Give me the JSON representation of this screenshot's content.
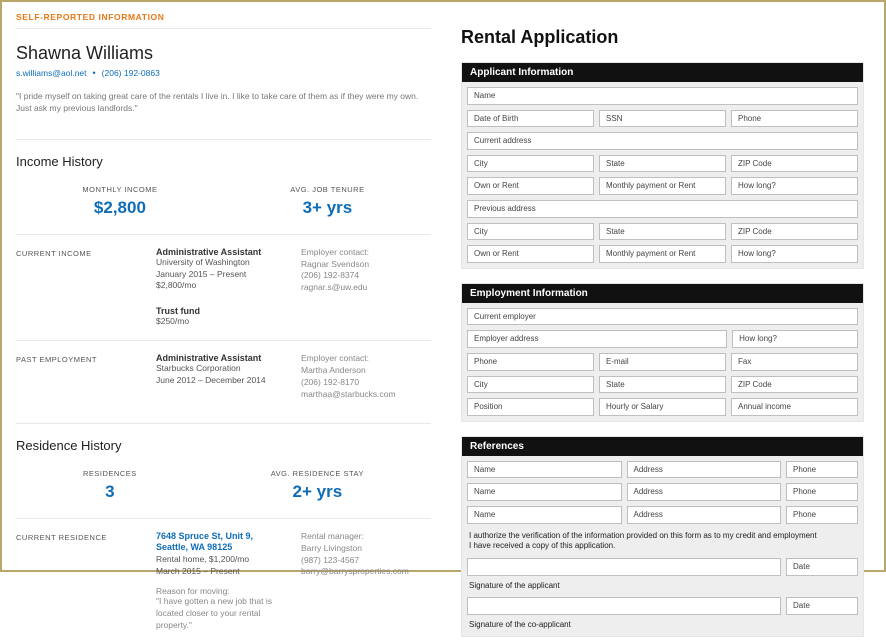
{
  "left": {
    "headerTag": "SELF-REPORTED INFORMATION",
    "name": "Shawna Williams",
    "email": "s.williams@aol.net",
    "phone": "(206) 192-0863",
    "quote": "\"I pride myself on taking great care of the rentals I live in. I like to take care of them as if they were my own. Just ask my previous landlords.\"",
    "income": {
      "heading": "Income History",
      "stats": {
        "monthlyLabel": "MONTHLY INCOME",
        "monthlyValue": "$2,800",
        "tenureLabel": "AVG. JOB TENURE",
        "tenureValue": "3+ yrs"
      },
      "current": {
        "label": "CURRENT INCOME",
        "job1": {
          "title": "Administrative Assistant",
          "org": "University of Washington",
          "dates": "January 2015 – Present",
          "amount": "$2,800/mo"
        },
        "job2": {
          "title": "Trust fund",
          "amount": "$250/mo"
        },
        "contactLabel": "Employer contact:",
        "contactName": "Ragnar Svendson",
        "contactPhone": "(206) 192-8374",
        "contactEmail": "ragnar.s@uw.edu"
      },
      "past": {
        "label": "PAST EMPLOYMENT",
        "title": "Administrative Assistant",
        "org": "Starbucks Corporation",
        "dates": "June 2012 – December 2014",
        "contactLabel": "Employer contact:",
        "contactName": "Martha Anderson",
        "contactPhone": "(206) 192-8170",
        "contactEmail": "marthaa@starbucks.com"
      }
    },
    "residence": {
      "heading": "Residence History",
      "stats": {
        "countLabel": "RESIDENCES",
        "countValue": "3",
        "stayLabel": "AVG. RESIDENCE STAY",
        "stayValue": "2+ yrs"
      },
      "current": {
        "label": "CURRENT RESIDENCE",
        "addr1": "7648 Spruce St, Unit 9,",
        "addr2": "Seattle, WA 98125",
        "sub": "Rental home, $1,200/mo",
        "dates": "March 2015 – Present",
        "reasonLabel": "Reason for moving:",
        "reasonText": "\"I have gotten a new job that is located closer to your rental property.\"",
        "contactLabel": "Rental manager:",
        "contactName": "Barry Livingston",
        "contactPhone": "(987) 123-4567",
        "contactEmail": "barry@barrysproperties.com"
      }
    }
  },
  "right": {
    "title": "Rental Application",
    "sections": {
      "applicant": {
        "heading": "Applicant Information",
        "f": {
          "name": "Name",
          "dob": "Date of Birth",
          "ssn": "SSN",
          "phone": "Phone",
          "currAddr": "Current address",
          "city": "City",
          "state": "State",
          "zip": "ZIP Code",
          "ownRent": "Own or Rent",
          "payment": "Monthly payment or Rent",
          "howLong": "How long?",
          "prevAddr": "Previous address"
        }
      },
      "employment": {
        "heading": "Employment Information",
        "f": {
          "emp": "Current employer",
          "empAddr": "Employer address",
          "howLong": "How long?",
          "phone": "Phone",
          "email": "E-mail",
          "fax": "Fax",
          "city": "City",
          "state": "State",
          "zip": "ZIP Code",
          "position": "Position",
          "hourly": "Hourly or Salary",
          "annual": "Annual income"
        }
      },
      "refs": {
        "heading": "References",
        "f": {
          "name": "Name",
          "address": "Address",
          "phone": "Phone"
        },
        "auth1": "I authorize the verification of the information provided on this form as to my credit and employment",
        "auth2": "I have received a copy of this application.",
        "sigApp": "Signature of the applicant",
        "sigCo": "Signature of the co-applicant",
        "date": "Date"
      }
    }
  }
}
